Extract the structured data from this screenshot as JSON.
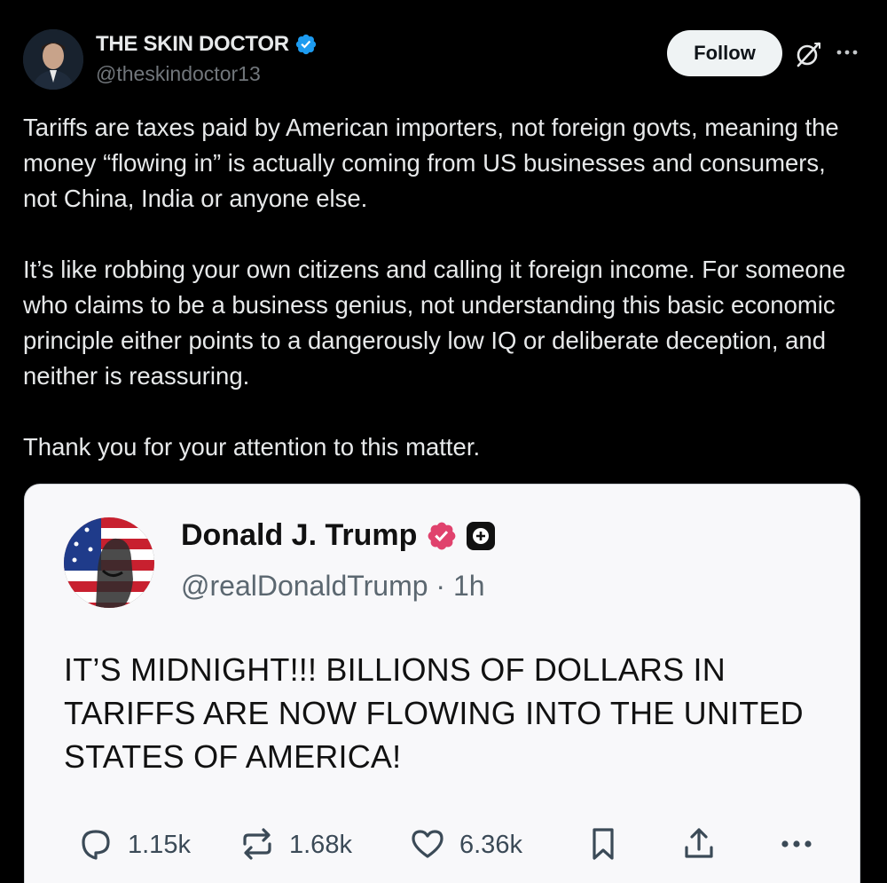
{
  "post": {
    "author_name": "THE SKIN DOCTOR",
    "author_handle": "@theskindoctor13",
    "follow_label": "Follow",
    "paragraphs": [
      "Tariffs are taxes paid by American importers, not foreign govts, meaning the money “flowing in” is actually coming from US businesses and consumers, not China, India or anyone else.",
      "It’s like robbing your own citizens and calling it foreign income. For someone who claims to be a business genius, not understanding this basic economic principle either points to a dangerously low IQ or deliberate deception, and neither is reassuring.",
      "Thank you for your attention to this matter."
    ]
  },
  "quoted": {
    "author_name": "Donald J. Trump",
    "author_handle": "@realDonaldTrump · 1h",
    "body": "IT’S MIDNIGHT!!! BILLIONS OF DOLLARS IN TARIFFS ARE NOW FLOWING INTO THE UNITED STATES OF AMERICA!",
    "replies": "1.15k",
    "restruths": "1.68k",
    "likes": "6.36k"
  },
  "colors": {
    "background": "#000000",
    "text_primary": "#e7e9ea",
    "text_secondary": "#71767b",
    "verified_blue": "#1d9bf0",
    "quote_card_bg": "#f8f8fa",
    "quote_badge_pink": "#e0426d",
    "quote_icon_gray": "#3b4a57"
  },
  "icons": {
    "header": [
      "verified-badge-icon",
      "grok-icon",
      "more-icon"
    ],
    "quoted": [
      "verified-badge-icon",
      "plus-icon",
      "reply-icon",
      "restruth-icon",
      "like-icon",
      "bookmark-icon",
      "share-icon",
      "more-icon"
    ]
  }
}
